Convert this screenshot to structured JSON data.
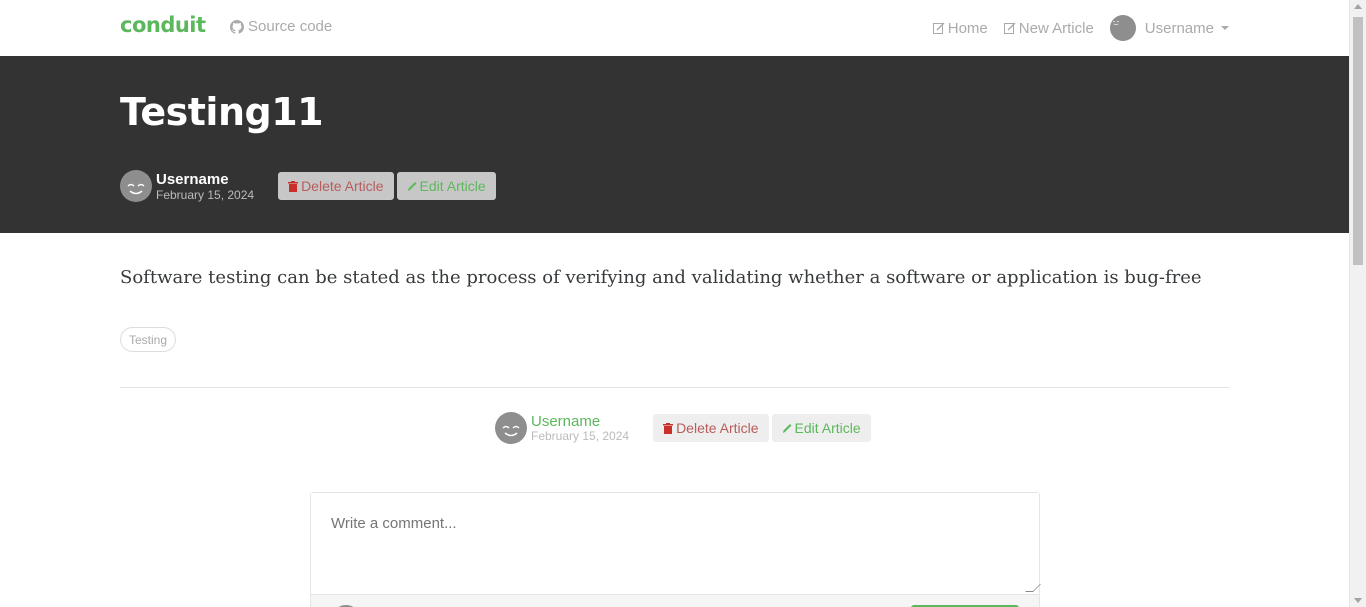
{
  "navbar": {
    "brand": "conduit",
    "source_code": "Source code",
    "home": "Home",
    "new_article": "New Article",
    "username": "Username"
  },
  "article": {
    "title": "Testing11",
    "author": "Username",
    "date": "February 15, 2024",
    "body": "Software testing can be stated as the process of verifying and validating whether a software or application is bug-free",
    "tags": [
      "Testing"
    ],
    "delete_label": "Delete Article",
    "edit_label": "Edit Article"
  },
  "comment": {
    "placeholder": "Write a comment..."
  },
  "colors": {
    "brand": "#5cb85c",
    "banner": "#333333",
    "danger": "#b85c5c"
  }
}
